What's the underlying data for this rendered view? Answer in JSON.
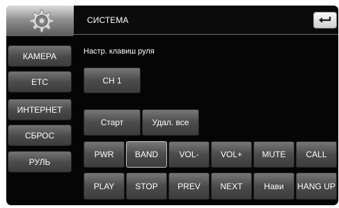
{
  "header": {
    "title": "СИСТЕМА",
    "logo_icon": "gear-icon",
    "back_icon": "return-arrow-icon"
  },
  "sidebar": {
    "items": [
      {
        "label": "КАМЕРА"
      },
      {
        "label": "ETC"
      },
      {
        "label": "ИНТЕРНЕТ"
      },
      {
        "label": "СБРОС"
      },
      {
        "label": "РУЛЬ"
      }
    ]
  },
  "main": {
    "section_label": "Настр. клавиш руля",
    "channel_button": "CH 1",
    "start_button": "Старт",
    "delete_all_button": "Удал. все",
    "keys_row1": [
      "PWR",
      "BAND",
      "VOL-",
      "VOL+",
      "MUTE",
      "CALL"
    ],
    "keys_row2": [
      "PLAY",
      "STOP",
      "PREV",
      "NEXT",
      "Нави",
      "HANG UP"
    ]
  }
}
